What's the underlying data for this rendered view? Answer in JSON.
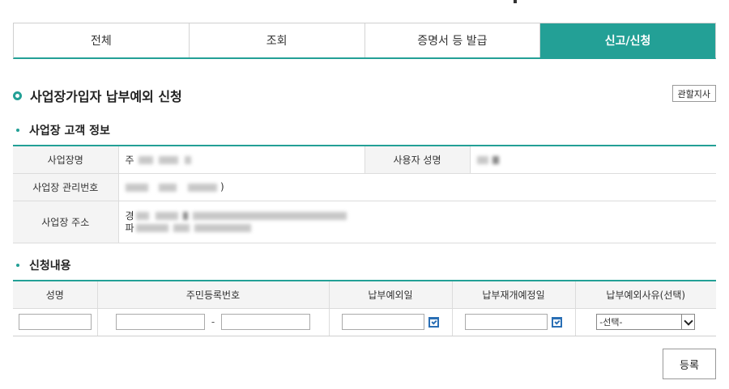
{
  "tabs": [
    {
      "label": "전체",
      "active": false
    },
    {
      "label": "조회",
      "active": false
    },
    {
      "label": "증명서 등 발급",
      "active": false
    },
    {
      "label": "신고/신청",
      "active": true
    }
  ],
  "page": {
    "title": "사업장가입자 납부예외 신청",
    "branch_button": "관할지사"
  },
  "customer_section": {
    "title": "사업장 고객 정보",
    "business_name_label": "사업장명",
    "business_name_value": "주",
    "user_name_label": "사용자 성명",
    "management_no_label": "사업장 관리번호",
    "management_no_suffix": ")",
    "address_label": "사업장 주소",
    "address_line1_prefix": "경",
    "address_line2_prefix": "파"
  },
  "apply_section": {
    "title": "신청내용",
    "columns": [
      "성명",
      "주민등록번호",
      "납부예외일",
      "납부재개예정일",
      "납부예외사유(선택)"
    ],
    "ssn_separator": "-",
    "reason_select": "-선택-"
  },
  "register_button": "등록",
  "colors": {
    "accent": "#23a096",
    "calendar_icon": "#2a6fb5"
  }
}
